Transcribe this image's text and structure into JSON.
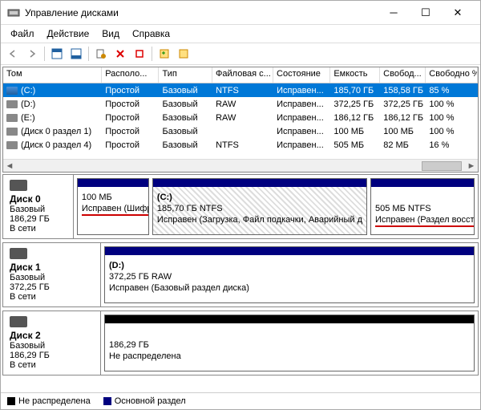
{
  "window": {
    "title": "Управление дисками"
  },
  "menu": {
    "file": "Файл",
    "action": "Действие",
    "view": "Вид",
    "help": "Справка"
  },
  "table": {
    "headers": [
      "Том",
      "Располо...",
      "Тип",
      "Файловая с...",
      "Состояние",
      "Емкость",
      "Свобод...",
      "Свободно %"
    ],
    "rows": [
      {
        "name": "(C:)",
        "layout": "Простой",
        "type": "Базовый",
        "fs": "NTFS",
        "status": "Исправен...",
        "cap": "185,70 ГБ",
        "free": "158,58 ГБ",
        "pct": "85 %",
        "selected": true,
        "blue": true
      },
      {
        "name": "(D:)",
        "layout": "Простой",
        "type": "Базовый",
        "fs": "RAW",
        "status": "Исправен...",
        "cap": "372,25 ГБ",
        "free": "372,25 ГБ",
        "pct": "100 %",
        "selected": false
      },
      {
        "name": "(E:)",
        "layout": "Простой",
        "type": "Базовый",
        "fs": "RAW",
        "status": "Исправен...",
        "cap": "186,12 ГБ",
        "free": "186,12 ГБ",
        "pct": "100 %",
        "selected": false
      },
      {
        "name": "(Диск 0 раздел 1)",
        "layout": "Простой",
        "type": "Базовый",
        "fs": "",
        "status": "Исправен...",
        "cap": "100 МБ",
        "free": "100 МБ",
        "pct": "100 %",
        "selected": false
      },
      {
        "name": "(Диск 0 раздел 4)",
        "layout": "Простой",
        "type": "Базовый",
        "fs": "NTFS",
        "status": "Исправен...",
        "cap": "505 МБ",
        "free": "82 МБ",
        "pct": "16 %",
        "selected": false
      }
    ]
  },
  "disks": {
    "d0": {
      "name": "Диск 0",
      "type": "Базовый",
      "size": "186,29 ГБ",
      "status": "В сети",
      "p1_size": "100 МБ",
      "p1_status": "Исправен (Шифр",
      "p2_name": "(C:)",
      "p2_size": "185,70 ГБ NTFS",
      "p2_status": "Исправен (Загрузка, Файл подкачки, Аварийный д",
      "p3_size": "505 МБ NTFS",
      "p3_status": "Исправен (Раздел восстан"
    },
    "d1": {
      "name": "Диск 1",
      "type": "Базовый",
      "size": "372,25 ГБ",
      "status": "В сети",
      "p1_name": "(D:)",
      "p1_size": "372,25 ГБ RAW",
      "p1_status": "Исправен (Базовый раздел диска)"
    },
    "d2": {
      "name": "Диск 2",
      "type": "Базовый",
      "size": "186,29 ГБ",
      "status": "В сети",
      "p1_size": "186,29 ГБ",
      "p1_status": "Не распределена"
    }
  },
  "legend": {
    "unalloc": "Не распределена",
    "primary": "Основной раздел"
  }
}
